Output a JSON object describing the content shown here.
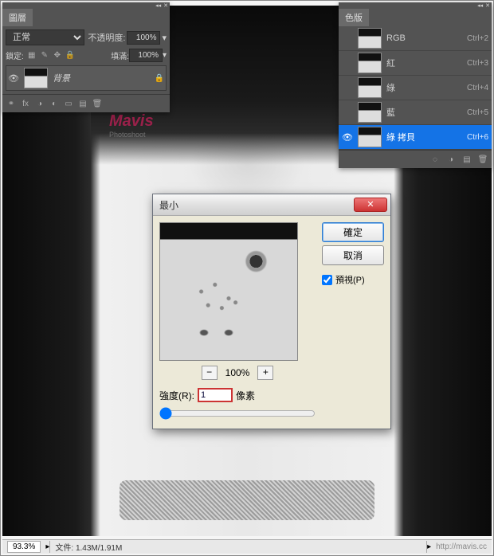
{
  "watermark": {
    "text": "Mavis",
    "sub": "Photoshoot"
  },
  "layers_panel": {
    "tab": "圖層",
    "blend_mode": "正常",
    "opacity_label": "不透明度:",
    "opacity_value": "100%",
    "lock_label": "鎖定:",
    "fill_label": "填滿:",
    "fill_value": "100%",
    "layer_name": "背景"
  },
  "channels_panel": {
    "tab": "色版",
    "items": [
      {
        "label": "RGB",
        "shortcut": "Ctrl+2",
        "selected": false,
        "visible": false
      },
      {
        "label": "紅",
        "shortcut": "Ctrl+3",
        "selected": false,
        "visible": false
      },
      {
        "label": "綠",
        "shortcut": "Ctrl+4",
        "selected": false,
        "visible": false
      },
      {
        "label": "藍",
        "shortcut": "Ctrl+5",
        "selected": false,
        "visible": false
      },
      {
        "label": "綠 拷貝",
        "shortcut": "Ctrl+6",
        "selected": true,
        "visible": true
      }
    ]
  },
  "dialog": {
    "title": "最小",
    "ok": "確定",
    "cancel": "取消",
    "preview_label": "預視(P)",
    "preview_checked": true,
    "zoom_pct": "100%",
    "radius_label": "強度(R):",
    "radius_value": "1",
    "radius_unit": "像素"
  },
  "status": {
    "zoom": "93.3%",
    "doc": "文件: 1.43M/1.91M",
    "url": "http://mavis.cc"
  }
}
